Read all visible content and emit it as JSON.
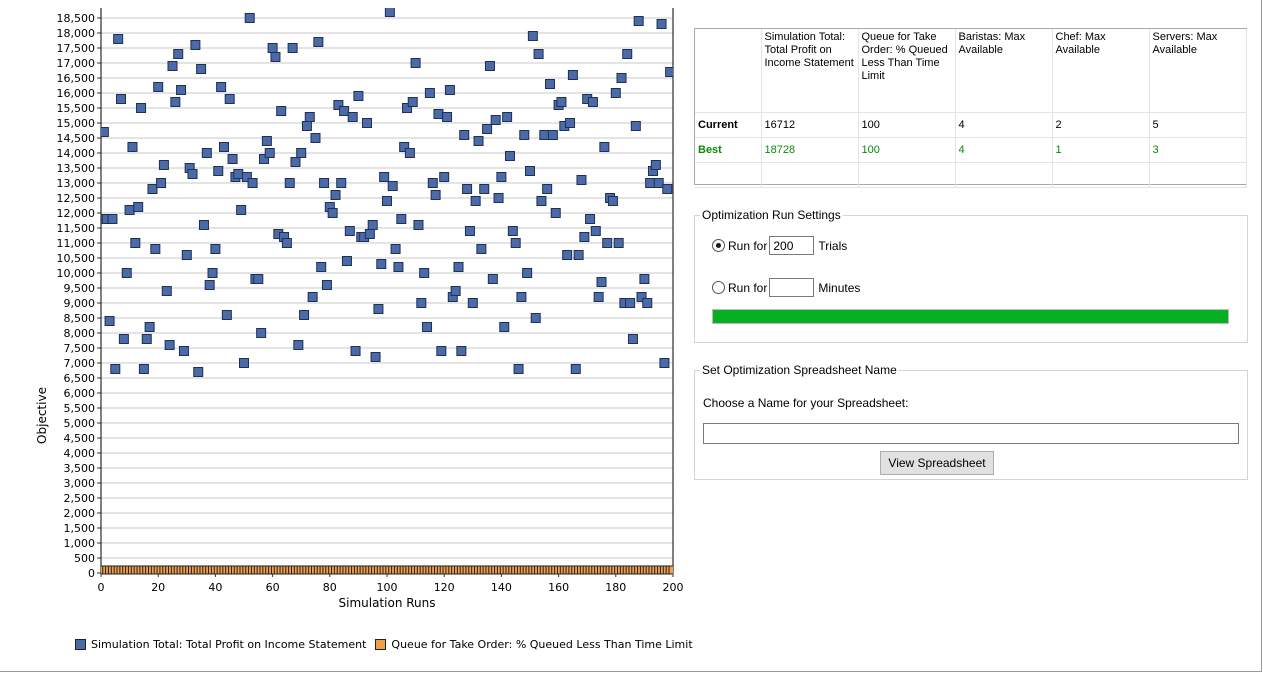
{
  "chart_data": {
    "type": "scatter",
    "xlabel": "Simulation Runs",
    "ylabel": "Objective",
    "xlim": [
      0,
      200
    ],
    "ylim": [
      0,
      18500
    ],
    "x_ticks": [
      0,
      20,
      40,
      60,
      80,
      100,
      120,
      140,
      160,
      180,
      200
    ],
    "y_ticks": [
      0,
      500,
      1000,
      1500,
      2000,
      2500,
      3000,
      3500,
      4000,
      4500,
      5000,
      5500,
      6000,
      6500,
      7000,
      7500,
      8000,
      8500,
      9000,
      9500,
      10000,
      10500,
      11000,
      11500,
      12000,
      12500,
      13000,
      13500,
      14000,
      14500,
      15000,
      15500,
      16000,
      16500,
      17000,
      17500,
      18000,
      18500
    ],
    "y_tick_labels": [
      "0",
      "500",
      "1,000",
      "1,500",
      "2,000",
      "2,500",
      "3,000",
      "3,500",
      "4,000",
      "4,500",
      "5,000",
      "5,500",
      "6,000",
      "6,500",
      "7,000",
      "7,500",
      "8,000",
      "8,500",
      "9,000",
      "9,500",
      "10,000",
      "10,500",
      "11,000",
      "11,500",
      "12,000",
      "12,500",
      "13,000",
      "13,500",
      "14,000",
      "14,500",
      "15,000",
      "15,500",
      "16,000",
      "16,500",
      "17,000",
      "17,500",
      "18,000",
      "18,500"
    ],
    "grid": true,
    "legend_position": "bottom-left",
    "series": [
      {
        "name": "Simulation Total: Total Profit on Income Statement",
        "color": "#4a6aa8",
        "points": [
          [
            1,
            14700
          ],
          [
            2,
            11800
          ],
          [
            3,
            8400
          ],
          [
            4,
            11800
          ],
          [
            5,
            6800
          ],
          [
            6,
            17800
          ],
          [
            7,
            15800
          ],
          [
            8,
            7800
          ],
          [
            9,
            10000
          ],
          [
            10,
            12100
          ],
          [
            11,
            14200
          ],
          [
            12,
            11000
          ],
          [
            13,
            12200
          ],
          [
            14,
            15500
          ],
          [
            15,
            6800
          ],
          [
            16,
            7800
          ],
          [
            17,
            8200
          ],
          [
            18,
            12800
          ],
          [
            19,
            10800
          ],
          [
            20,
            16200
          ],
          [
            21,
            13000
          ],
          [
            22,
            13600
          ],
          [
            23,
            9400
          ],
          [
            24,
            7600
          ],
          [
            25,
            16900
          ],
          [
            26,
            15700
          ],
          [
            27,
            17300
          ],
          [
            28,
            16100
          ],
          [
            29,
            7400
          ],
          [
            30,
            10600
          ],
          [
            31,
            13500
          ],
          [
            32,
            13300
          ],
          [
            33,
            17600
          ],
          [
            34,
            6700
          ],
          [
            35,
            16800
          ],
          [
            36,
            11600
          ],
          [
            37,
            14000
          ],
          [
            38,
            9600
          ],
          [
            39,
            10000
          ],
          [
            40,
            10800
          ],
          [
            41,
            13400
          ],
          [
            42,
            16200
          ],
          [
            43,
            14200
          ],
          [
            44,
            8600
          ],
          [
            45,
            15800
          ],
          [
            46,
            13800
          ],
          [
            47,
            13200
          ],
          [
            48,
            13300
          ],
          [
            49,
            12100
          ],
          [
            50,
            7000
          ],
          [
            51,
            13200
          ],
          [
            52,
            18500
          ],
          [
            53,
            13000
          ],
          [
            54,
            9800
          ],
          [
            55,
            9800
          ],
          [
            56,
            8000
          ],
          [
            57,
            13800
          ],
          [
            58,
            14400
          ],
          [
            59,
            14000
          ],
          [
            60,
            17500
          ],
          [
            61,
            17200
          ],
          [
            62,
            11300
          ],
          [
            63,
            15400
          ],
          [
            64,
            11200
          ],
          [
            65,
            11000
          ],
          [
            66,
            13000
          ],
          [
            67,
            17500
          ],
          [
            68,
            13700
          ],
          [
            69,
            7600
          ],
          [
            70,
            14000
          ],
          [
            71,
            8600
          ],
          [
            72,
            14900
          ],
          [
            73,
            15200
          ],
          [
            74,
            9200
          ],
          [
            75,
            14500
          ],
          [
            76,
            17700
          ],
          [
            77,
            10200
          ],
          [
            78,
            13000
          ],
          [
            79,
            9600
          ],
          [
            80,
            12200
          ],
          [
            81,
            12000
          ],
          [
            82,
            12600
          ],
          [
            83,
            15600
          ],
          [
            84,
            13000
          ],
          [
            85,
            15400
          ],
          [
            86,
            10400
          ],
          [
            87,
            11400
          ],
          [
            88,
            15200
          ],
          [
            89,
            7400
          ],
          [
            90,
            15900
          ],
          [
            91,
            11200
          ],
          [
            92,
            11200
          ],
          [
            93,
            15000
          ],
          [
            94,
            11300
          ],
          [
            95,
            11600
          ],
          [
            96,
            7200
          ],
          [
            97,
            8800
          ],
          [
            98,
            10300
          ],
          [
            99,
            13200
          ],
          [
            100,
            12400
          ],
          [
            101,
            18700
          ],
          [
            102,
            12900
          ],
          [
            103,
            10800
          ],
          [
            104,
            10200
          ],
          [
            105,
            11800
          ],
          [
            106,
            14200
          ],
          [
            107,
            15500
          ],
          [
            108,
            14000
          ],
          [
            109,
            15700
          ],
          [
            110,
            17000
          ],
          [
            111,
            11600
          ],
          [
            112,
            9000
          ],
          [
            113,
            10000
          ],
          [
            114,
            8200
          ],
          [
            115,
            16000
          ],
          [
            116,
            13000
          ],
          [
            117,
            12600
          ],
          [
            118,
            15300
          ],
          [
            119,
            7400
          ],
          [
            120,
            13200
          ],
          [
            121,
            15200
          ],
          [
            122,
            16100
          ],
          [
            123,
            9200
          ],
          [
            124,
            9400
          ],
          [
            125,
            10200
          ],
          [
            126,
            7400
          ],
          [
            127,
            14600
          ],
          [
            128,
            12800
          ],
          [
            129,
            11400
          ],
          [
            130,
            9000
          ],
          [
            131,
            12400
          ],
          [
            132,
            14400
          ],
          [
            133,
            10800
          ],
          [
            134,
            12800
          ],
          [
            135,
            14800
          ],
          [
            136,
            16900
          ],
          [
            137,
            9800
          ],
          [
            138,
            15100
          ],
          [
            139,
            12500
          ],
          [
            140,
            13200
          ],
          [
            141,
            8200
          ],
          [
            142,
            15200
          ],
          [
            143,
            13900
          ],
          [
            144,
            11400
          ],
          [
            145,
            11000
          ],
          [
            146,
            6800
          ],
          [
            147,
            9200
          ],
          [
            148,
            14600
          ],
          [
            149,
            10000
          ],
          [
            150,
            13400
          ],
          [
            151,
            17900
          ],
          [
            152,
            8500
          ],
          [
            153,
            17300
          ],
          [
            154,
            12400
          ],
          [
            155,
            14600
          ],
          [
            156,
            12800
          ],
          [
            157,
            16300
          ],
          [
            158,
            14600
          ],
          [
            159,
            12000
          ],
          [
            160,
            15600
          ],
          [
            161,
            15700
          ],
          [
            162,
            14900
          ],
          [
            163,
            10600
          ],
          [
            164,
            15000
          ],
          [
            165,
            16600
          ],
          [
            166,
            6800
          ],
          [
            167,
            10600
          ],
          [
            168,
            13100
          ],
          [
            169,
            11200
          ],
          [
            170,
            15800
          ],
          [
            171,
            11800
          ],
          [
            172,
            15700
          ],
          [
            173,
            11400
          ],
          [
            174,
            9200
          ],
          [
            175,
            9700
          ],
          [
            176,
            14200
          ],
          [
            177,
            11000
          ],
          [
            178,
            12500
          ],
          [
            179,
            12400
          ],
          [
            180,
            16000
          ],
          [
            181,
            11000
          ],
          [
            182,
            16500
          ],
          [
            183,
            9000
          ],
          [
            184,
            17300
          ],
          [
            185,
            9000
          ],
          [
            186,
            7800
          ],
          [
            187,
            14900
          ],
          [
            188,
            18400
          ],
          [
            189,
            9200
          ],
          [
            190,
            9800
          ],
          [
            191,
            9000
          ],
          [
            192,
            13000
          ],
          [
            193,
            13400
          ],
          [
            194,
            13600
          ],
          [
            195,
            13000
          ],
          [
            196,
            18300
          ],
          [
            197,
            7000
          ],
          [
            198,
            12800
          ],
          [
            199,
            16700
          ]
        ]
      },
      {
        "name": "Queue for Take Order: % Queued Less Than Time Limit",
        "color": "#f0a04b",
        "constant_value": 100,
        "x_range": [
          0,
          200
        ]
      }
    ]
  },
  "results_table": {
    "headers": [
      "",
      "Simulation Total: Total Profit on Income Statement",
      "Queue for Take Order: % Queued Less Than Time Limit",
      "Baristas: Max Available",
      "Chef: Max Available",
      "Servers: Max Available"
    ],
    "rows": [
      {
        "label": "Current",
        "values": [
          "16712",
          "100",
          "4",
          "2",
          "5"
        ]
      },
      {
        "label": "Best",
        "values": [
          "18728",
          "100",
          "4",
          "1",
          "3"
        ]
      }
    ]
  },
  "optimization_settings": {
    "title": "Optimization Run Settings",
    "run_for_label": "Run for",
    "trials_value": "200",
    "trials_label": "Trials",
    "minutes_value": "",
    "minutes_label": "Minutes",
    "selected_mode": "trials",
    "progress_fraction": 1.0,
    "progress_color": "#06b025"
  },
  "spreadsheet": {
    "title": "Set Optimization Spreadsheet Name",
    "prompt": "Choose a Name for your Spreadsheet:",
    "name_value": "",
    "view_button_label": "View Spreadsheet"
  }
}
